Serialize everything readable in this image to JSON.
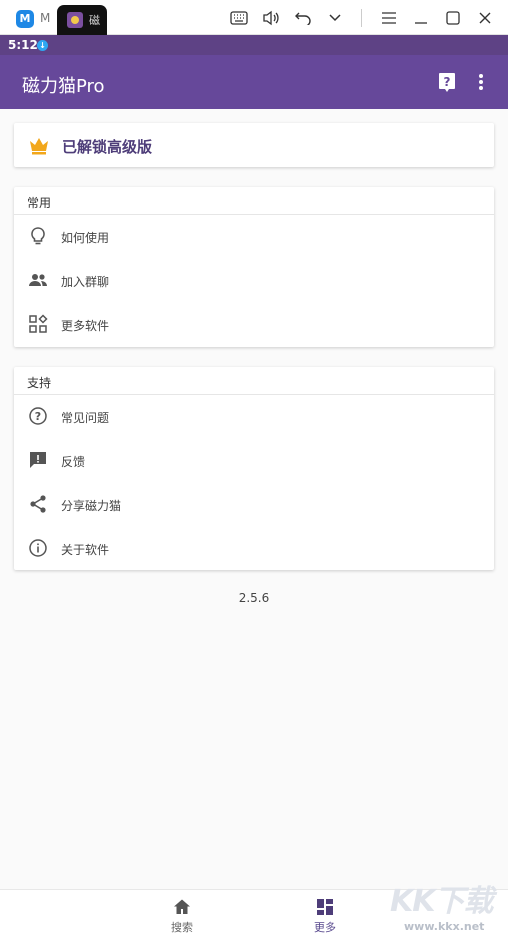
{
  "window": {
    "app_label": "M",
    "tab_label": "磁"
  },
  "status_bar": {
    "time": "5:12"
  },
  "app_bar": {
    "title": "磁力猫Pro"
  },
  "premium": {
    "label": "已解锁高级版"
  },
  "sections": [
    {
      "title": "常用",
      "items": [
        {
          "label": "如何使用",
          "icon": "lightbulb-icon"
        },
        {
          "label": "加入群聊",
          "icon": "group-icon"
        },
        {
          "label": "更多软件",
          "icon": "apps-icon"
        }
      ]
    },
    {
      "title": "支持",
      "items": [
        {
          "label": "常见问题",
          "icon": "help-circle-icon"
        },
        {
          "label": "反馈",
          "icon": "feedback-icon"
        },
        {
          "label": "分享磁力猫",
          "icon": "share-icon"
        },
        {
          "label": "关于软件",
          "icon": "info-icon"
        }
      ]
    }
  ],
  "version": "2.5.6",
  "bottom_nav": [
    {
      "label": "搜索",
      "icon": "home-icon",
      "active": false
    },
    {
      "label": "更多",
      "icon": "dashboard-icon",
      "active": true
    }
  ],
  "watermark": {
    "main": "KK下载",
    "sub": "www.kkx.net"
  },
  "colors": {
    "app_bar": "#66489a",
    "status_bar": "#5e4285",
    "accent": "#5a4b8f",
    "crown": "#f2a71b"
  }
}
